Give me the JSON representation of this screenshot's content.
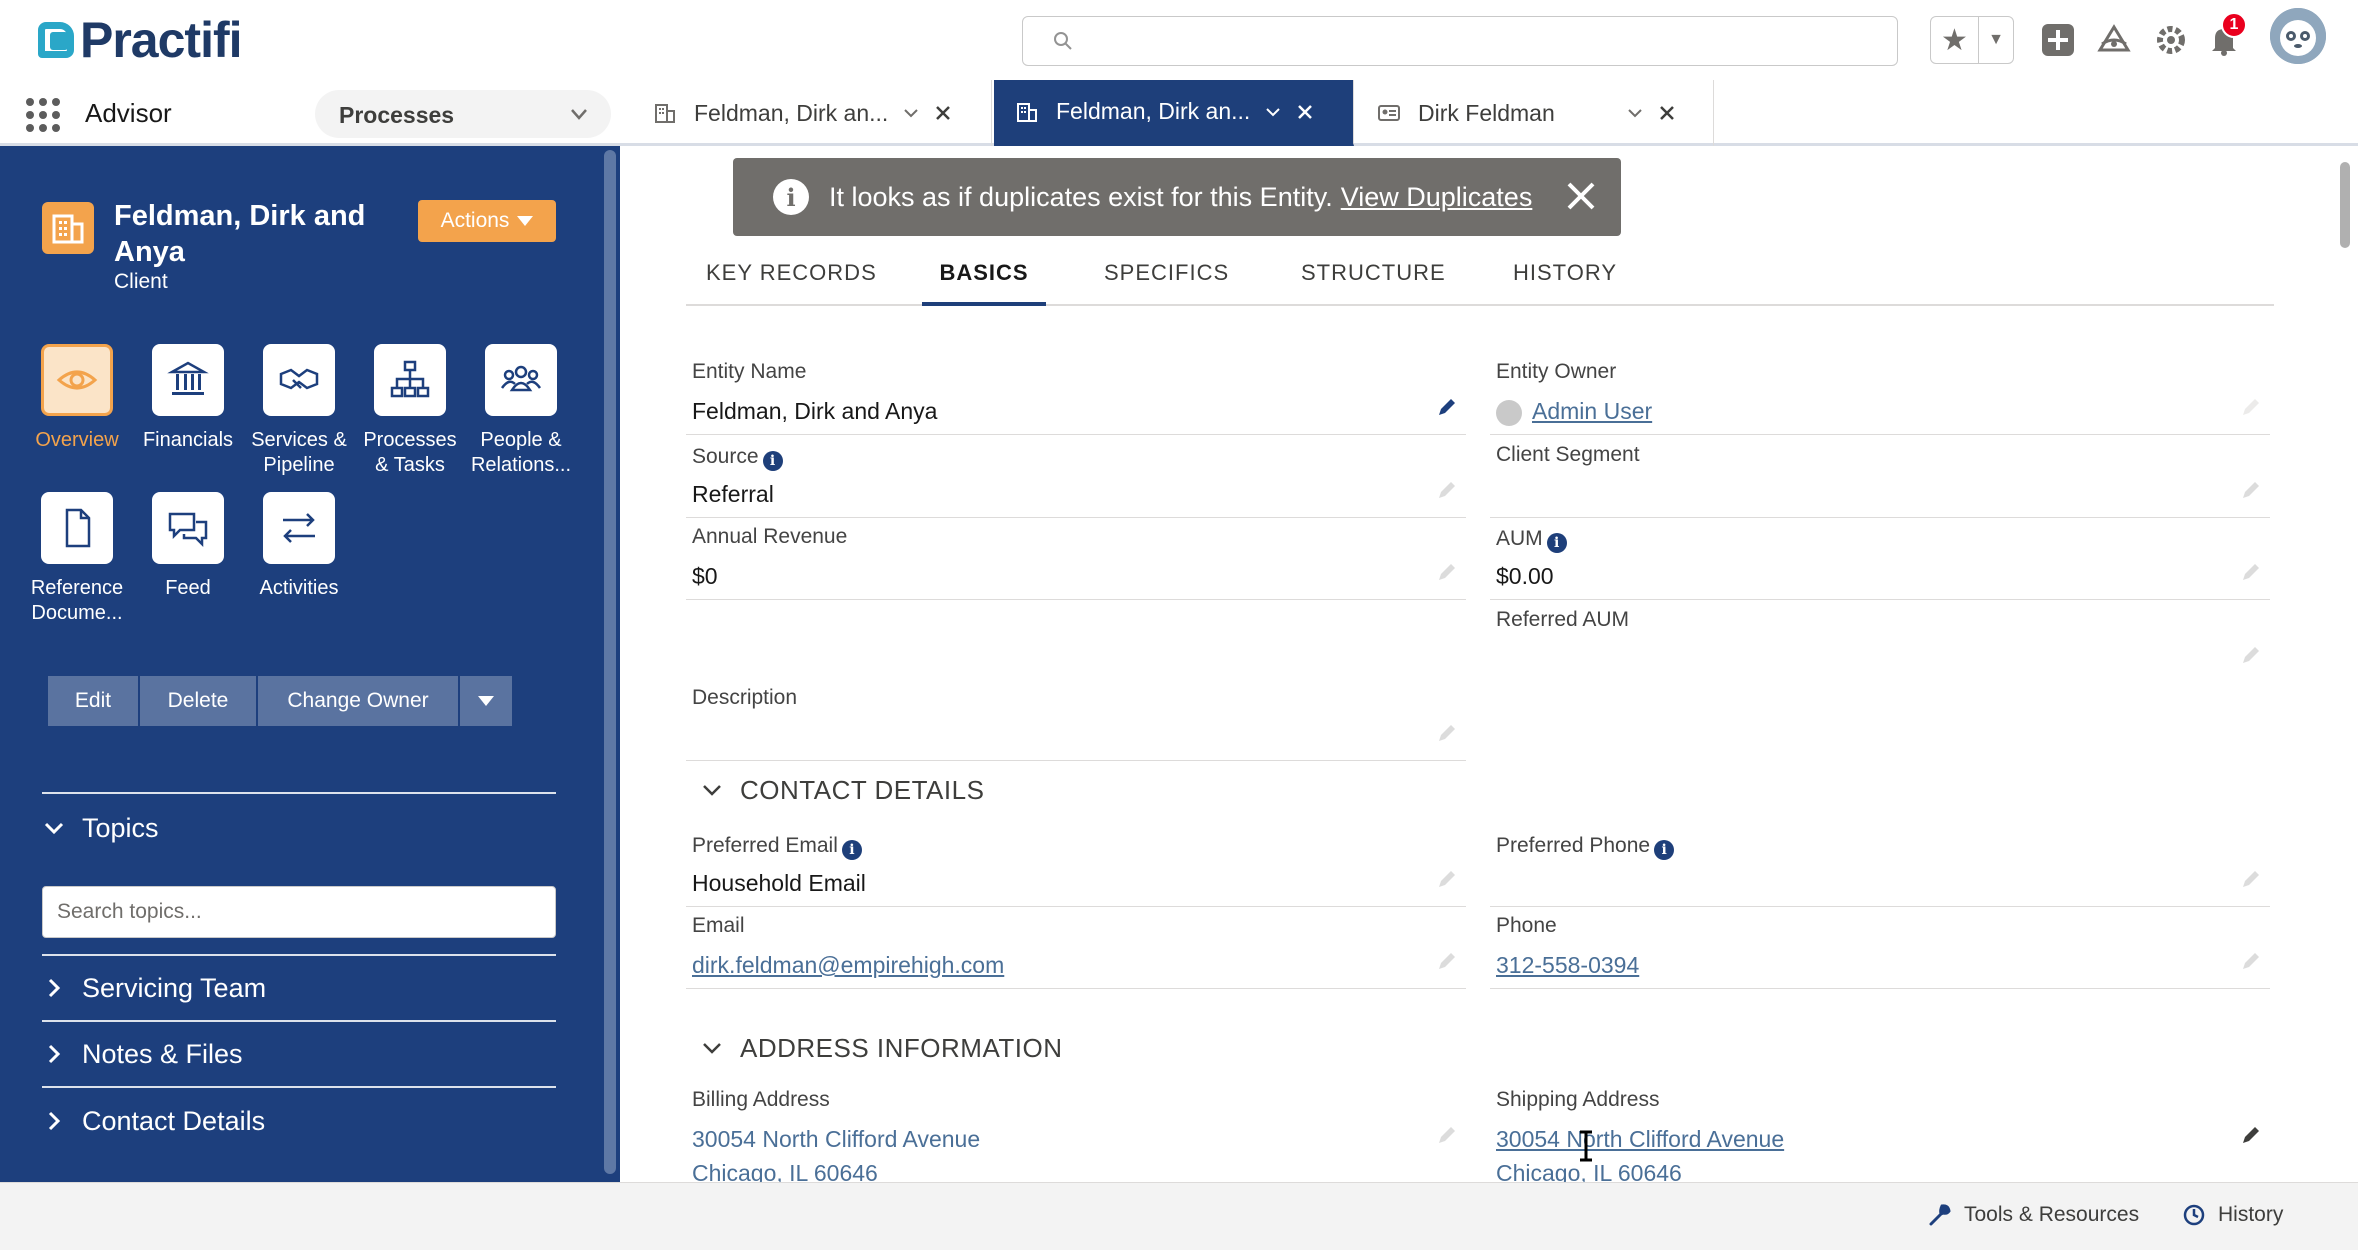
{
  "header": {
    "brand": "Practifi",
    "notification_count": "1"
  },
  "nav": {
    "app_name": "Advisor",
    "process_select": "Processes",
    "tabs": [
      {
        "label": "Feldman, Dirk an...",
        "active": false
      },
      {
        "label": "Feldman, Dirk an...",
        "active": true
      },
      {
        "label": "Dirk Feldman",
        "active": false
      }
    ]
  },
  "record": {
    "title": "Feldman, Dirk and Anya",
    "type": "Client",
    "actions_label": "Actions"
  },
  "tiles": [
    {
      "label": "Overview",
      "icon": "eye-icon"
    },
    {
      "label": "Financials",
      "icon": "bank-icon"
    },
    {
      "label": "Services & Pipeline",
      "icon": "handshake-icon"
    },
    {
      "label": "Processes & Tasks",
      "icon": "hierarchy-icon"
    },
    {
      "label": "People & Relations...",
      "icon": "people-icon"
    },
    {
      "label": "Reference Docume...",
      "icon": "document-icon"
    },
    {
      "label": "Feed",
      "icon": "chat-icon"
    },
    {
      "label": "Activities",
      "icon": "swap-icon"
    }
  ],
  "record_buttons": {
    "edit": "Edit",
    "delete": "Delete",
    "change_owner": "Change Owner"
  },
  "sidebar_sections": {
    "topics": "Topics",
    "topics_search_placeholder": "Search topics...",
    "servicing_team": "Servicing Team",
    "notes_files": "Notes & Files",
    "contact_details": "Contact Details"
  },
  "toast": {
    "message": "It looks as if duplicates exist for this Entity.",
    "link": "View Duplicates"
  },
  "subtabs": [
    "KEY RECORDS",
    "BASICS",
    "SPECIFICS",
    "STRUCTURE",
    "HISTORY"
  ],
  "basics": {
    "entity_name_label": "Entity Name",
    "entity_name": "Feldman, Dirk and Anya",
    "entity_owner_label": "Entity Owner",
    "entity_owner": "Admin User",
    "source_label": "Source",
    "source": "Referral",
    "client_segment_label": "Client Segment",
    "client_segment": "",
    "annual_revenue_label": "Annual Revenue",
    "annual_revenue": "$0",
    "aum_label": "AUM",
    "aum": "$0.00",
    "referred_aum_label": "Referred AUM",
    "referred_aum": "",
    "description_label": "Description",
    "description": ""
  },
  "contact_details": {
    "section_title": "CONTACT DETAILS",
    "preferred_email_label": "Preferred Email",
    "preferred_email": "Household Email",
    "preferred_phone_label": "Preferred Phone",
    "preferred_phone": "",
    "email_label": "Email",
    "email": "dirk.feldman@empirehigh.com",
    "phone_label": "Phone",
    "phone": "312-558-0394"
  },
  "address": {
    "section_title": "ADDRESS INFORMATION",
    "billing_label": "Billing Address",
    "billing_line1": "30054 North Clifford Avenue",
    "billing_line2": "Chicago, IL 60646",
    "shipping_label": "Shipping Address",
    "shipping_line1": "30054 North Clifford Avenue",
    "shipping_line2": "Chicago, IL 60646"
  },
  "footer": {
    "tools": "Tools & Resources",
    "history": "History"
  },
  "colors": {
    "brand_navy": "#1d3f7d",
    "accent_orange": "#f3a34c",
    "link": "#4a6f97",
    "toast_gray": "#706e6b",
    "badge_red": "#ea001e"
  }
}
